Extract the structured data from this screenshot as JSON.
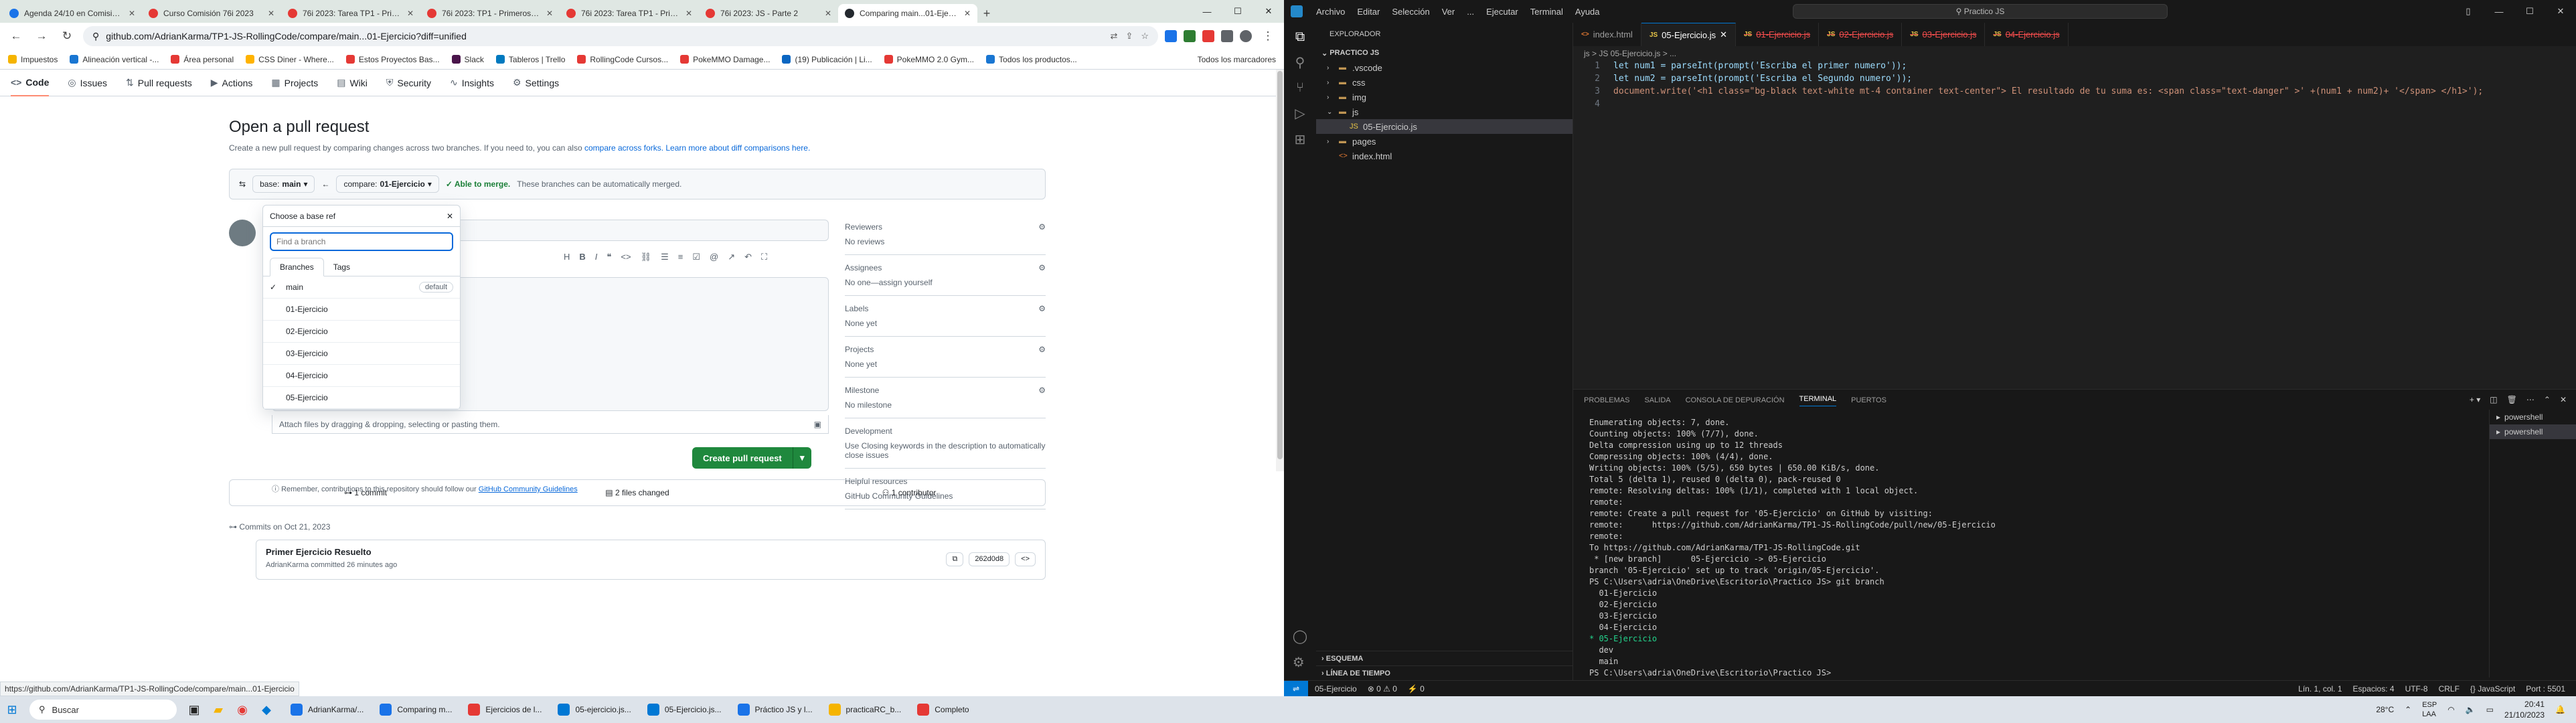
{
  "browser": {
    "tabs": [
      {
        "title": "Agenda 24/10 en Comisión 76i",
        "color": "#1a73e8"
      },
      {
        "title": "Curso Comisión 76i 2023",
        "color": "#e53935"
      },
      {
        "title": "76i 2023: Tarea TP1 - Primeros ej",
        "color": "#e53935"
      },
      {
        "title": "76i 2023: TP1 - Primeros ejercici",
        "color": "#e53935"
      },
      {
        "title": "76i 2023: Tarea TP1 - Primeros",
        "color": "#e53935"
      },
      {
        "title": "76i 2023: JS - Parte 2",
        "color": "#e53935"
      },
      {
        "title": "Comparing main...01-Ejercicio",
        "color": "#24292f",
        "active": true
      }
    ],
    "url": "github.com/AdrianKarma/TP1-JS-RollingCode/compare/main...01-Ejercicio?diff=unified",
    "bookmarks": [
      {
        "label": "Impuestos",
        "color": "#f5b400"
      },
      {
        "label": "Alineación vertical -...",
        "color": "#1976d2"
      },
      {
        "label": "Área personal",
        "color": "#e53935"
      },
      {
        "label": "CSS Diner - Where...",
        "color": "#ffb300"
      },
      {
        "label": "Estos Proyectos Bas...",
        "color": "#e53935"
      },
      {
        "label": "Slack",
        "color": "#4a154b"
      },
      {
        "label": "Tableros | Trello",
        "color": "#0079bf"
      },
      {
        "label": "RollingCode Cursos...",
        "color": "#e53935"
      },
      {
        "label": "PokeMMO Damage...",
        "color": "#e53935"
      },
      {
        "label": "(19) Publicación | Li...",
        "color": "#0a66c2"
      },
      {
        "label": "PokeMMO 2.0 Gym...",
        "color": "#e53935"
      },
      {
        "label": "Todos los productos...",
        "color": "#1976d2"
      }
    ],
    "bookmarks_all": "Todos los marcadores",
    "status_url": "https://github.com/AdrianKarma/TP1-JS-RollingCode/compare/main...01-Ejercicio"
  },
  "github": {
    "repo_tabs": [
      {
        "label": "Code",
        "icon": "<>",
        "selected": true
      },
      {
        "label": "Issues",
        "icon": "◎"
      },
      {
        "label": "Pull requests",
        "icon": "⇅"
      },
      {
        "label": "Actions",
        "icon": "▶"
      },
      {
        "label": "Projects",
        "icon": "▦"
      },
      {
        "label": "Wiki",
        "icon": "▤"
      },
      {
        "label": "Security",
        "icon": "⛨"
      },
      {
        "label": "Insights",
        "icon": "∿"
      },
      {
        "label": "Settings",
        "icon": "⚙"
      }
    ],
    "title": "Open a pull request",
    "subtitle_pre": "Create a new pull request by comparing changes across two branches. If you need to, you can also",
    "subtitle_link1": "compare across forks.",
    "subtitle_link2": "Learn more about diff comparisons here.",
    "base_label": "base:",
    "base_value": "main",
    "compare_label": "compare:",
    "compare_value": "01-Ejercicio",
    "merge_ok": "✓ Able to merge.",
    "merge_desc": "These branches can be automatically merged.",
    "dropdown": {
      "title": "Choose a base ref",
      "placeholder": "Find a branch",
      "tabs": [
        "Branches",
        "Tags"
      ],
      "items": [
        {
          "name": "main",
          "checked": true,
          "badge": "default"
        },
        {
          "name": "01-Ejercicio"
        },
        {
          "name": "02-Ejercicio"
        },
        {
          "name": "03-Ejercicio"
        },
        {
          "name": "04-Ejercicio"
        },
        {
          "name": "05-Ejercicio"
        }
      ]
    },
    "attach_text": "Attach files by dragging & dropping, selecting or pasting them.",
    "create_button": "Create pull request",
    "remember_pre": "Remember, contributions to this repository should follow our",
    "remember_link": "GitHub Community Guidelines",
    "sidebar": [
      {
        "heading": "Reviewers",
        "value": "No reviews",
        "gear": true
      },
      {
        "heading": "Assignees",
        "value": "No one—assign yourself",
        "gear": true
      },
      {
        "heading": "Labels",
        "value": "None yet",
        "gear": true
      },
      {
        "heading": "Projects",
        "value": "None yet",
        "gear": true
      },
      {
        "heading": "Milestone",
        "value": "No milestone",
        "gear": true
      },
      {
        "heading": "Development",
        "value": "Use Closing keywords in the description to automatically close issues",
        "gear": false
      },
      {
        "heading": "Helpful resources",
        "value": "GitHub Community Guidelines",
        "gear": false
      }
    ],
    "stats": {
      "commits": "1 commit",
      "files": "2 files changed",
      "contributors": "1 contributor"
    },
    "commits_date": "Commits on Oct 21, 2023",
    "commit": {
      "message": "Primer Ejercicio Resuelto",
      "author": "AdrianKarma",
      "time": "committed 26 minutes ago",
      "sha": "262d0d8"
    }
  },
  "vscode": {
    "menu": [
      "Archivo",
      "Editar",
      "Selección",
      "Ver",
      "...",
      "Ejecutar",
      "Terminal",
      "Ayuda"
    ],
    "search": "Practico JS",
    "explorer_heading": "EXPLORADOR",
    "project": "PRACTICO JS",
    "tree": [
      {
        "name": ".vscode",
        "type": "folder",
        "depth": 1
      },
      {
        "name": "css",
        "type": "folder",
        "depth": 1
      },
      {
        "name": "img",
        "type": "folder",
        "depth": 1
      },
      {
        "name": "js",
        "type": "folder-open",
        "depth": 1
      },
      {
        "name": "05-Ejercicio.js",
        "type": "js",
        "depth": 2,
        "selected": true
      },
      {
        "name": "pages",
        "type": "folder",
        "depth": 1
      },
      {
        "name": "index.html",
        "type": "html",
        "depth": 1
      }
    ],
    "outline": [
      "ESQUEMA",
      "LÍNEA DE TIEMPO"
    ],
    "editor_tabs": [
      {
        "name": "index.html",
        "kind": "html"
      },
      {
        "name": "05-Ejercicio.js",
        "kind": "js",
        "active": true
      },
      {
        "name": "01-Ejercicio.js",
        "kind": "js",
        "deleted": true
      },
      {
        "name": "02-Ejercicio.js",
        "kind": "js",
        "deleted": true
      },
      {
        "name": "03-Ejercicio.js",
        "kind": "js",
        "deleted": true
      },
      {
        "name": "04-Ejercicio.js",
        "kind": "js",
        "deleted": true
      }
    ],
    "breadcrumb": "js > JS 05-Ejercicio.js > ...",
    "code_lines": [
      "let num1 = parseInt(prompt('Escriba el primer numero'));",
      "let num2 = parseInt(prompt('Escriba el Segundo numero'));",
      "document.write('<h1 class=\"bg-black text-white mt-4 container text-center\"> El resultado de tu suma es: <span class=\"text-danger\" >' +(num1 + num2)+ '</span> </h1>');",
      ""
    ],
    "panel_tabs": [
      "PROBLEMAS",
      "SALIDA",
      "CONSOLA DE DEPURACIÓN",
      "TERMINAL",
      "PUERTOS"
    ],
    "panel_active": "TERMINAL",
    "terminal_lines": [
      "Enumerating objects: 7, done.",
      "Counting objects: 100% (7/7), done.",
      "Delta compression using up to 12 threads",
      "Compressing objects: 100% (4/4), done.",
      "Writing objects: 100% (5/5), 650 bytes | 650.00 KiB/s, done.",
      "Total 5 (delta 1), reused 0 (delta 0), pack-reused 0",
      "remote: Resolving deltas: 100% (1/1), completed with 1 local object.",
      "remote:",
      "remote: Create a pull request for '05-Ejercicio' on GitHub by visiting:",
      "remote:      https://github.com/AdrianKarma/TP1-JS-RollingCode/pull/new/05-Ejercicio",
      "remote:",
      "To https://github.com/AdrianKarma/TP1-JS-RollingCode.git",
      " * [new branch]      05-Ejercicio -> 05-Ejercicio",
      "branch '05-Ejercicio' set up to track 'origin/05-Ejercicio'.",
      "PS C:\\Users\\adria\\OneDrive\\Escritorio\\Practico JS> git branch",
      "  01-Ejercicio",
      "  02-Ejercicio",
      "  03-Ejercicio",
      "  04-Ejercicio",
      "* 05-Ejercicio",
      "  dev",
      "  main",
      "PS C:\\Users\\adria\\OneDrive\\Escritorio\\Practico JS> "
    ],
    "terminals": [
      "powershell",
      "powershell"
    ],
    "status_left": [
      "05-Ejercicio",
      "⊗ 0  ⚠ 0",
      "⚡ 0"
    ],
    "status_right": [
      "Lín. 1, col. 1",
      "Espacios: 4",
      "UTF-8",
      "CRLF",
      "{} JavaScript",
      "Port : 5501"
    ]
  },
  "taskbar": {
    "search": "Buscar",
    "apps": [
      {
        "label": "AdrianKarma/...",
        "color": "#1a73e8"
      },
      {
        "label": "Comparing m...",
        "color": "#1a73e8"
      },
      {
        "label": "Ejercicios de l...",
        "color": "#e53935"
      },
      {
        "label": "05-ejercicio.js...",
        "color": "#0078d4"
      },
      {
        "label": "05-Ejercicio.js...",
        "color": "#0078d4"
      },
      {
        "label": "Práctico JS y l...",
        "color": "#1a73e8"
      },
      {
        "label": "practicaRC_b...",
        "color": "#f5b400"
      },
      {
        "label": "Completo",
        "color": "#e53935"
      }
    ],
    "weather": "28°C",
    "lang": "ESP\nLAA",
    "time": "20:41",
    "date": "21/10/2023"
  }
}
